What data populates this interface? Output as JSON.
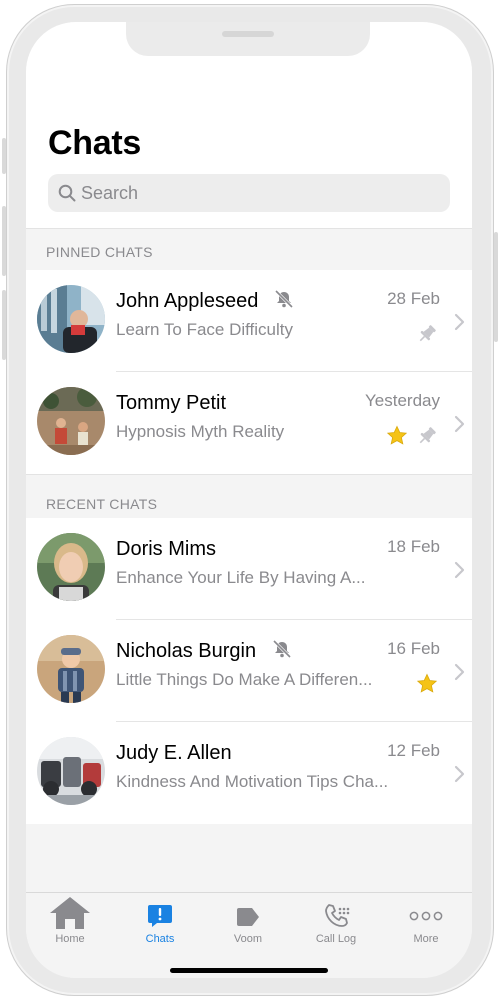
{
  "header": {
    "title": "Chats"
  },
  "search": {
    "placeholder": "Search"
  },
  "sections": {
    "pinned": "PINNED CHATS",
    "recent": "RECENT CHATS"
  },
  "chats": [
    {
      "name": "John Appleseed",
      "message": "Learn To Face Difficulty",
      "date": "28 Feb",
      "muted": true,
      "pinned": true,
      "starred": false
    },
    {
      "name": "Tommy Petit",
      "message": "Hypnosis Myth Reality",
      "date": "Yesterday",
      "muted": false,
      "pinned": true,
      "starred": true
    },
    {
      "name": "Doris Mims",
      "message": "Enhance Your Life By Having A...",
      "date": "18 Feb",
      "muted": false,
      "pinned": false,
      "starred": false
    },
    {
      "name": "Nicholas Burgin",
      "message": "Little Things Do Make A Differen...",
      "date": "16 Feb",
      "muted": true,
      "pinned": false,
      "starred": true
    },
    {
      "name": "Judy E. Allen",
      "message": "Kindness And Motivation Tips Cha...",
      "date": "12 Feb",
      "muted": false,
      "pinned": false,
      "starred": false
    }
  ],
  "tabs": [
    {
      "label": "Home",
      "icon": "home-icon",
      "active": false
    },
    {
      "label": "Chats",
      "icon": "chat-alert-icon",
      "active": true
    },
    {
      "label": "Voom",
      "icon": "voom-tag-icon",
      "active": false
    },
    {
      "label": "Call Log",
      "icon": "phone-icon",
      "active": false
    },
    {
      "label": "More",
      "icon": "more-dots-icon",
      "active": false
    }
  ],
  "colors": {
    "accent": "#1a82e2",
    "star": "#f5c316",
    "secondary_text": "#8a8a8e",
    "icon_gray": "#c7c7cc"
  }
}
